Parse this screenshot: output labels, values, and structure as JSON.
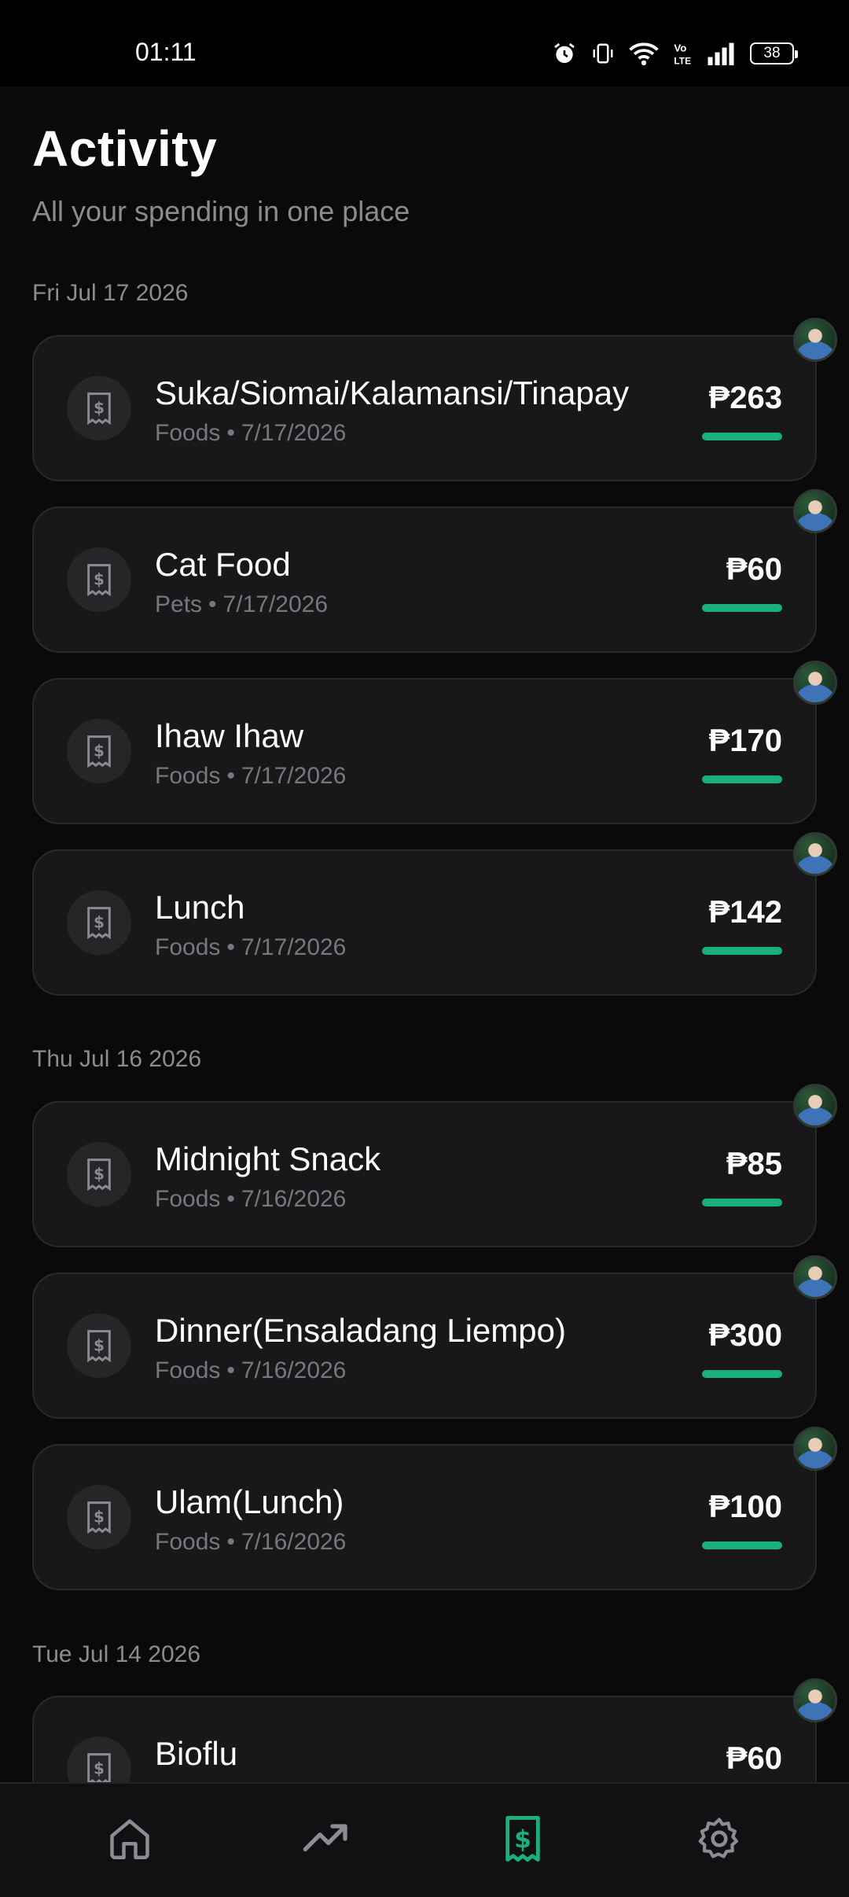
{
  "status_bar": {
    "time": "01:11",
    "battery": "38",
    "icons": [
      "alarm-icon",
      "vibrate-icon",
      "wifi-icon",
      "volte-icon",
      "signal-icon",
      "battery-icon"
    ]
  },
  "header": {
    "title": "Activity",
    "subtitle": "All your spending in one place"
  },
  "groups": [
    {
      "date": "Fri Jul 17 2026",
      "items": [
        {
          "title": "Suka/Siomai/Kalamansi/Tinapay",
          "category": "Foods",
          "date": "7/17/2026",
          "amount": "₱263"
        },
        {
          "title": "Cat Food",
          "category": "Pets",
          "date": "7/17/2026",
          "amount": "₱60"
        },
        {
          "title": "Ihaw Ihaw",
          "category": "Foods",
          "date": "7/17/2026",
          "amount": "₱170"
        },
        {
          "title": "Lunch",
          "category": "Foods",
          "date": "7/17/2026",
          "amount": "₱142"
        }
      ]
    },
    {
      "date": "Thu Jul 16 2026",
      "items": [
        {
          "title": "Midnight Snack",
          "category": "Foods",
          "date": "7/16/2026",
          "amount": "₱85"
        },
        {
          "title": "Dinner(Ensaladang Liempo)",
          "category": "Foods",
          "date": "7/16/2026",
          "amount": "₱300"
        },
        {
          "title": "Ulam(Lunch)",
          "category": "Foods",
          "date": "7/16/2026",
          "amount": "₱100"
        }
      ]
    },
    {
      "date": "Tue Jul 14 2026",
      "items": [
        {
          "title": "Bioflu",
          "category": "",
          "date": "",
          "amount": "₱60"
        }
      ]
    }
  ],
  "meta_separator": "•",
  "bottom_nav": {
    "items": [
      {
        "icon": "home-icon",
        "active": false
      },
      {
        "icon": "trending-up-icon",
        "active": false
      },
      {
        "icon": "receipt-dollar-icon",
        "active": true
      },
      {
        "icon": "gear-icon",
        "active": false
      }
    ]
  },
  "colors": {
    "background": "#0a0a0b",
    "card": "#18181a",
    "accent": "#19b07a",
    "muted_text": "#8b8b90"
  }
}
